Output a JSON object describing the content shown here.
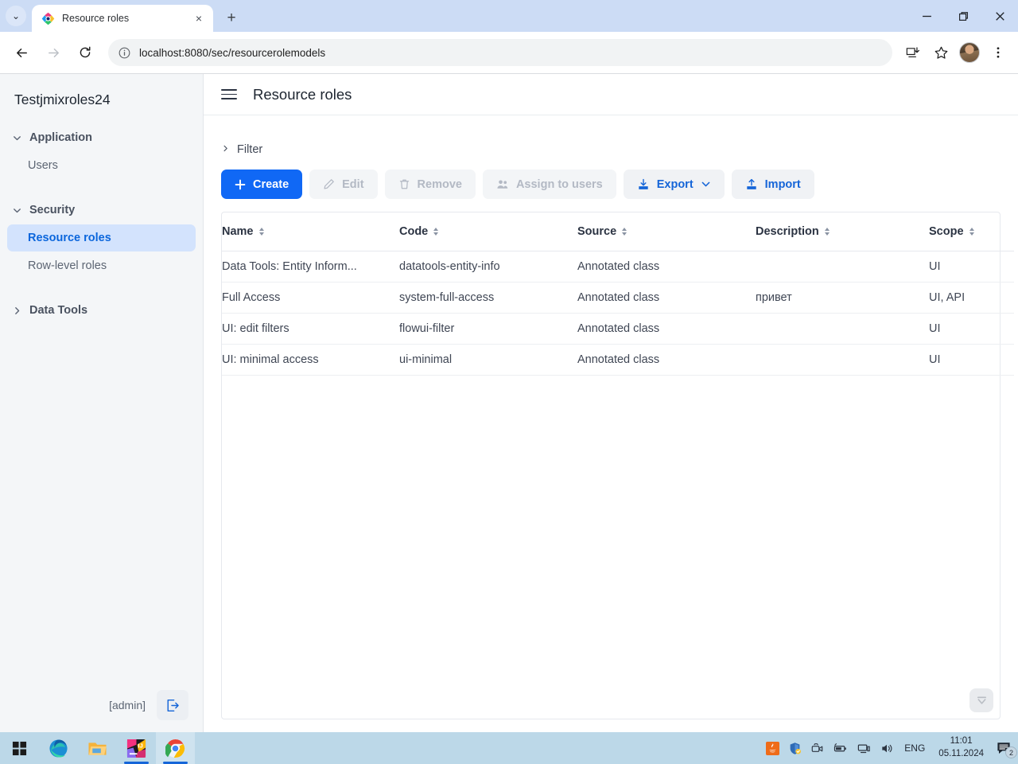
{
  "browser": {
    "tab": {
      "title": "Resource roles",
      "favicon": "jmix-logo-icon",
      "close": "×"
    },
    "tabstrip_chevron": "⌄",
    "new_tab": "+",
    "window_controls": {
      "minimize": "minimize-icon",
      "maximize": "maximize-icon",
      "close": "close-icon"
    },
    "nav": {
      "back": "back-arrow-icon",
      "forward": "forward-arrow-icon",
      "reload": "reload-icon"
    },
    "omnibox": {
      "url": "localhost:8080/sec/resourcerolemodels",
      "info_icon": "site-info-icon"
    },
    "actions": {
      "install": "install-app-icon",
      "bookmark": "bookmark-star-icon",
      "profile": "profile-avatar",
      "menu": "three-dot-menu-icon"
    }
  },
  "sidebar": {
    "brand": "Testjmixroles24",
    "groups": [
      {
        "label": "Application",
        "expanded": true,
        "chevron": "chevron-down",
        "items": [
          {
            "label": "Users",
            "active": false
          }
        ]
      },
      {
        "label": "Security",
        "expanded": true,
        "chevron": "chevron-down",
        "items": [
          {
            "label": "Resource roles",
            "active": true
          },
          {
            "label": "Row-level roles",
            "active": false
          }
        ]
      },
      {
        "label": "Data Tools",
        "expanded": false,
        "chevron": "chevron-right",
        "items": []
      }
    ],
    "footer": {
      "user": "[admin]",
      "logout_icon": "logout-icon"
    }
  },
  "content": {
    "menu_icon": "hamburger-menu-icon",
    "title": "Resource roles",
    "filter": {
      "label": "Filter",
      "chevron": "chevron-right",
      "expanded": false
    },
    "buttons": [
      {
        "label": "Create",
        "icon": "plus-icon",
        "style": "primary",
        "disabled": false,
        "dropdown": false
      },
      {
        "label": "Edit",
        "icon": "pencil-icon",
        "style": "ghost",
        "disabled": true,
        "dropdown": false
      },
      {
        "label": "Remove",
        "icon": "trash-icon",
        "style": "ghost",
        "disabled": true,
        "dropdown": false
      },
      {
        "label": "Assign to users",
        "icon": "users-icon",
        "style": "ghost",
        "disabled": true,
        "dropdown": false
      },
      {
        "label": "Export",
        "icon": "download-icon",
        "style": "ghost",
        "disabled": false,
        "dropdown": true
      },
      {
        "label": "Import",
        "icon": "upload-icon",
        "style": "ghost",
        "disabled": false,
        "dropdown": false
      }
    ],
    "table": {
      "columns": [
        {
          "label": "Name",
          "sortable": true
        },
        {
          "label": "Code",
          "sortable": true
        },
        {
          "label": "Source",
          "sortable": true
        },
        {
          "label": "Description",
          "sortable": true
        },
        {
          "label": "Scope",
          "sortable": true
        }
      ],
      "rows": [
        {
          "name": "Data Tools: Entity Inform...",
          "code": "datatools-entity-info",
          "source": "Annotated class",
          "description": "",
          "scope": "UI"
        },
        {
          "name": "Full Access",
          "code": "system-full-access",
          "source": "Annotated class",
          "description": "привет",
          "scope": "UI, API"
        },
        {
          "name": "UI: edit filters",
          "code": "flowui-filter",
          "source": "Annotated class",
          "description": "",
          "scope": "UI"
        },
        {
          "name": "UI: minimal access",
          "code": "ui-minimal",
          "source": "Annotated class",
          "description": "",
          "scope": "UI"
        }
      ]
    },
    "fab_icon": "collapse-down-icon"
  },
  "taskbar": {
    "apps": [
      {
        "name": "start-button-icon"
      },
      {
        "name": "microsoft-edge-icon"
      },
      {
        "name": "file-explorer-icon"
      },
      {
        "name": "intellij-idea-icon"
      },
      {
        "name": "google-chrome-icon"
      }
    ],
    "tray": {
      "icons": [
        "java-icon",
        "security-shield-icon",
        "camera-icon",
        "battery-icon",
        "network-icon",
        "volume-icon"
      ],
      "language": "ENG",
      "time": "11:01",
      "date": "05.11.2024",
      "notifications": "2"
    }
  },
  "colors": {
    "accent": "#1068f5",
    "accent_text": "#1565d8",
    "sidebar_active_bg": "#d3e3fd",
    "tabstrip": "#ccdcf5",
    "taskbar": "#bcd8e8"
  }
}
